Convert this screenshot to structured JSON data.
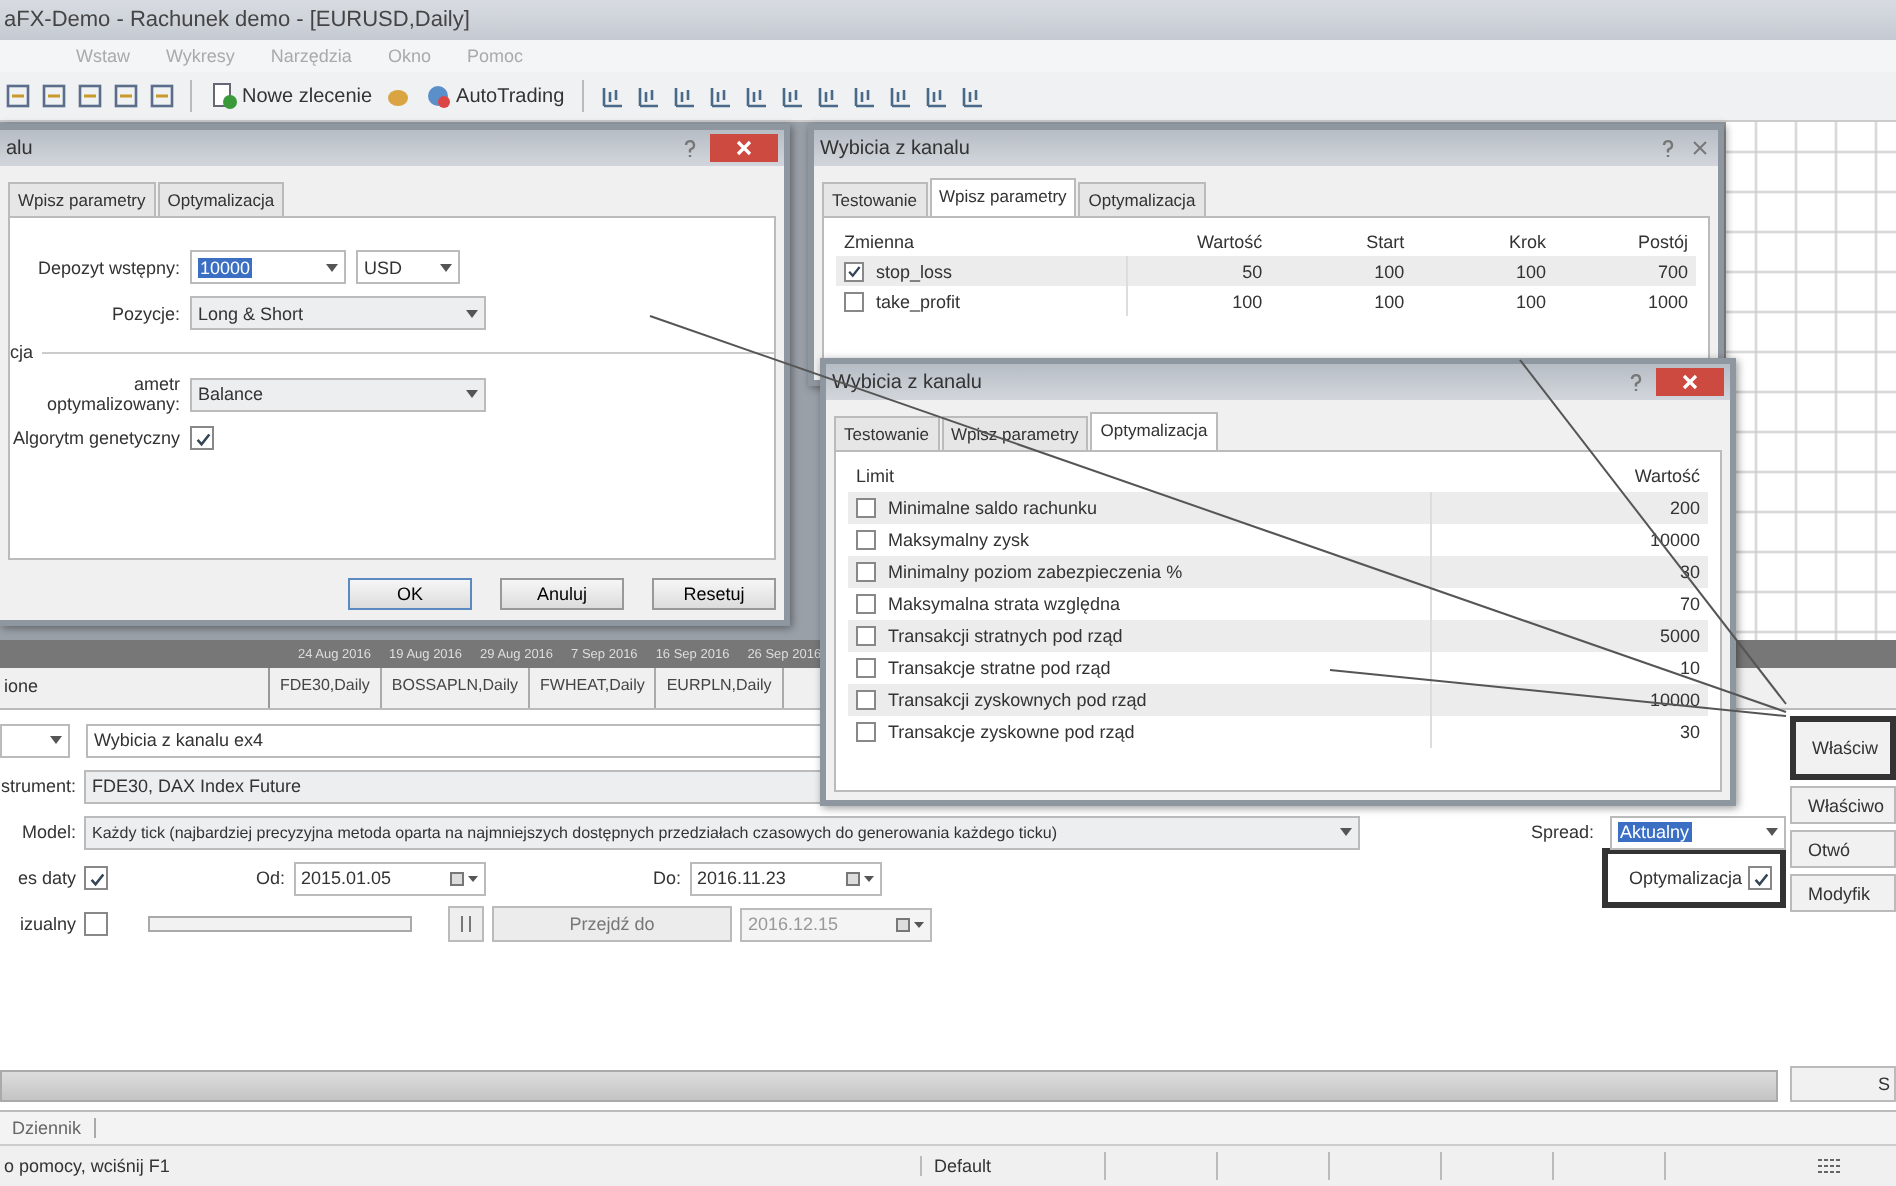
{
  "window": {
    "title": "aFX-Demo - Rachunek demo - [EURUSD,Daily]"
  },
  "menu": [
    "Wstaw",
    "Wykresy",
    "Narzędzia",
    "Okno",
    "Pomoc"
  ],
  "toolbar": {
    "new_order": "Nowe zlecenie",
    "autotrading": "AutoTrading"
  },
  "chart": {
    "dates": [
      "24 Aug 2016",
      "19 Aug 2016",
      "29 Aug 2016",
      "7 Sep 2016",
      "16 Sep 2016",
      "26 Sep 2016"
    ],
    "tabs": [
      {
        "label": "FDE30,Daily",
        "selected": false
      },
      {
        "label": "BOSSAPLN,Daily",
        "selected": false
      },
      {
        "label": "FWHEAT,Daily",
        "selected": false
      },
      {
        "label": "EURPLN,Daily",
        "selected": false
      }
    ],
    "side_tab": "ione"
  },
  "tester": {
    "expert": "Wybicia z kanalu ex4",
    "instrument_label": "strument:",
    "instrument": "FDE30, DAX Index Future",
    "model_label": "Model:",
    "model": "Każdy tick (najbardziej precyzyjna metoda oparta na najmniejszych dostępnych przedziałach czasowych do generowania każdego ticku)",
    "spread_label": "Spread:",
    "spread": "Aktualny",
    "use_date": {
      "label": "es daty",
      "checked": true
    },
    "from_label": "Od:",
    "from": "2015.01.05",
    "to_label": "Do:",
    "to": "2016.11.23",
    "optimization": {
      "label": "Optymalizacja",
      "checked": true
    },
    "visual": {
      "label": "izualny",
      "checked": false
    },
    "speed": {
      "level": 0
    },
    "skip_to": {
      "label": "Przejdź do",
      "date": "2016.12.15",
      "disabled": true
    },
    "progress": {
      "level": 0
    },
    "side_buttons": [
      {
        "label": "Właściw",
        "highlighted": true
      },
      {
        "label": "Właściwo",
        "highlighted": false
      },
      {
        "label": "Otwó",
        "highlighted": false
      },
      {
        "label": "Modyfik",
        "highlighted": false
      }
    ],
    "start": "S"
  },
  "bottom_tabs": [
    "Dziennik"
  ],
  "status_bar": {
    "help": "o pomocy, wciśnij F1",
    "profile": "Default"
  },
  "dialog_settings": {
    "title": "alu",
    "tabs": [
      {
        "label": "Wpisz parametry",
        "selected": false
      },
      {
        "label": "Optymalizacja",
        "selected": false
      }
    ],
    "deposit_label": "Depozyt wstępny:",
    "deposit": "10000",
    "currency": "USD",
    "positions_label": "Pozycje:",
    "positions": "Long & Short",
    "group": "cja",
    "param_label": "ametr optymalizowany:",
    "param": "Balance",
    "genetic": {
      "label": "Algorytm genetyczny",
      "checked": true
    },
    "buttons": [
      "OK",
      "Anuluj",
      "Resetuj"
    ]
  },
  "dialog_inputs": {
    "title": "Wybicia z kanalu",
    "tabs": [
      {
        "label": "Testowanie",
        "selected": false
      },
      {
        "label": "Wpisz parametry",
        "selected": true
      },
      {
        "label": "Optymalizacja",
        "selected": false
      }
    ],
    "columns": [
      "Zmienna",
      "Wartość",
      "Start",
      "Krok",
      "Postój"
    ],
    "rows": [
      {
        "checked": true,
        "cells": [
          "stop_loss",
          "50",
          "100",
          "100",
          "700"
        ]
      },
      {
        "checked": false,
        "cells": [
          "take_profit",
          "100",
          "100",
          "100",
          "1000"
        ]
      }
    ]
  },
  "dialog_optimization": {
    "title": "Wybicia z kanalu",
    "tabs": [
      {
        "label": "Testowanie",
        "selected": false
      },
      {
        "label": "Wpisz parametry",
        "selected": false
      },
      {
        "label": "Optymalizacja",
        "selected": true
      }
    ],
    "columns": [
      "Limit",
      "Wartość"
    ],
    "rows": [
      {
        "checked": false,
        "label": "Minimalne saldo rachunku",
        "value": "200"
      },
      {
        "checked": false,
        "label": "Maksymalny zysk",
        "value": "10000"
      },
      {
        "checked": false,
        "label": "Minimalny poziom zabezpieczenia %",
        "value": "30"
      },
      {
        "checked": false,
        "label": "Maksymalna strata względna",
        "value": "70"
      },
      {
        "checked": false,
        "label": "Transakcji stratnych pod rząd",
        "value": "5000"
      },
      {
        "checked": false,
        "label": "Transakcje stratne pod rząd",
        "value": "10"
      },
      {
        "checked": false,
        "label": "Transakcji zyskownych pod rząd",
        "value": "10000"
      },
      {
        "checked": false,
        "label": "Transakcje zyskowne pod rząd",
        "value": "30"
      }
    ]
  }
}
